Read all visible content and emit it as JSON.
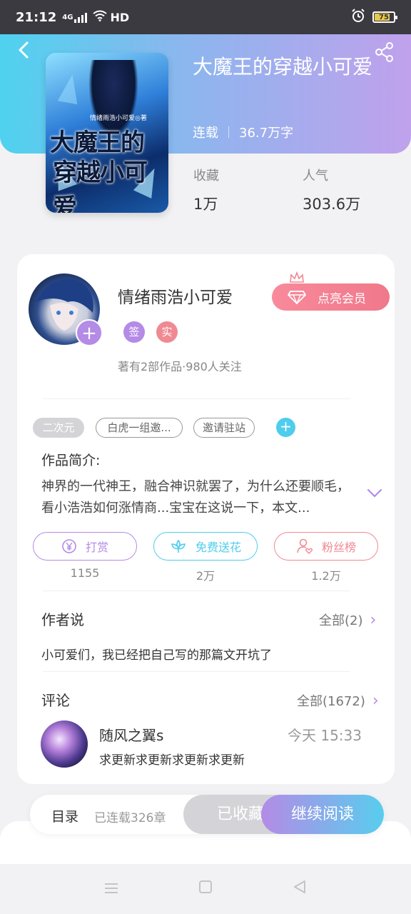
{
  "status_bar": {
    "time": "21:12",
    "network": "4G",
    "hd": "HD",
    "battery": "75"
  },
  "book": {
    "title": "大魔王的穿越小可爱",
    "status": "连载",
    "word_count": "36.7万字",
    "stats": [
      {
        "label": "收藏",
        "value": "1万"
      },
      {
        "label": "人气",
        "value": "303.6万"
      }
    ],
    "cover": {
      "title_line1": "大魔王的",
      "title_line2": "穿越小可爱",
      "author_mark": "情绪雨浩小可爱◎著"
    }
  },
  "author": {
    "name": "情绪雨浩小可爱",
    "badges": [
      {
        "text": "签",
        "color": "#b48be6"
      },
      {
        "text": "实",
        "color": "#f08a92"
      }
    ],
    "summary": "著有2部作品·980人关注",
    "vip_label": "点亮会员"
  },
  "tags": [
    "二次元",
    "白虎一组邀...",
    "邀请驻站"
  ],
  "intro": {
    "title": "作品简介:",
    "text": "神界的一代神王，融合神识就罢了，为什么还要顺毛，看小浩浩如何涨情商...宝宝在这说一下，本文..."
  },
  "actions": [
    {
      "label": "打赏",
      "count": "1155",
      "color": "#b48be6"
    },
    {
      "label": "免费送花",
      "count": "2万",
      "color": "#4fcdec"
    },
    {
      "label": "粉丝榜",
      "count": "1.2万",
      "color": "#f08a92"
    }
  ],
  "author_says": {
    "title": "作者说",
    "more": "全部(2)",
    "text": "小可爱们，我已经把自己写的那篇文开坑了"
  },
  "comments": {
    "title": "评论",
    "more": "全部(1672)",
    "items": [
      {
        "user": "随风之翼s",
        "time": "今天 15:33",
        "text": "求更新求更新求更新求更新"
      }
    ]
  },
  "bottom_bar": {
    "toc": "目录",
    "chapters": "已连载326章",
    "collected": "已收藏",
    "continue": "继续阅读"
  }
}
